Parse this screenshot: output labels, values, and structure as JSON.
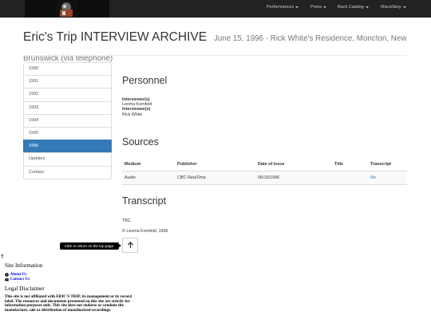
{
  "nav": {
    "logo_alt": "Eric's Trip logo",
    "items": [
      {
        "label": "Performances"
      },
      {
        "label": "Press"
      },
      {
        "label": "Back Catalog"
      },
      {
        "label": "Miscellany"
      }
    ]
  },
  "header": {
    "title": "Eric's Trip INTERVIEW ARCHIVE",
    "subtitle_line1": "June 15, 1996 - Rick White's Residence, Moncton, New",
    "subtitle_line2": "Brunswick (via telephone)"
  },
  "years": [
    {
      "label": "1990"
    },
    {
      "label": "1991"
    },
    {
      "label": "1992"
    },
    {
      "label": "1993"
    },
    {
      "label": "1994"
    },
    {
      "label": "1995"
    },
    {
      "label": "1996",
      "active": true
    },
    {
      "label": "Updates"
    },
    {
      "label": "Contact"
    }
  ],
  "personnel": {
    "heading": "Personnel",
    "interviewer_label": "Interviewer(s)",
    "interviewer": "Leoma Kornfeld",
    "interviewee_label": "Interviewee(s)",
    "interviewee": "Rick White"
  },
  "sources": {
    "heading": "Sources",
    "columns": [
      "Medium",
      "Publisher",
      "Date of Issue",
      "Title",
      "Transcript"
    ],
    "rows": [
      {
        "medium": "Audio",
        "publisher": "CBC RealTime",
        "date": "06/15/1996",
        "title": "",
        "transcript": "No"
      }
    ]
  },
  "transcript": {
    "heading": "Transcript",
    "body": "TBC.",
    "copyright": "© Leoma Kornfeld, 1996"
  },
  "back_to_top": {
    "tooltip": "Click to return on the top page."
  },
  "footer": {
    "arrow": "↑",
    "site_info_heading": "Site Information",
    "about_link": "About Us",
    "contact_link": "Contact Us",
    "legal_heading": "Legal Disclaimer",
    "disclaimer": "This site is not affiliated with ERIC'S TRIP, its management or its record label. The resources and documents presented on this site are strictly for information purposes only. This site does not endorse or condone the manufacture, sale or distribution of unauthorized recordings."
  },
  "colors": {
    "navbar": "#222222",
    "active": "#337ab7",
    "link": "#337ab7"
  }
}
